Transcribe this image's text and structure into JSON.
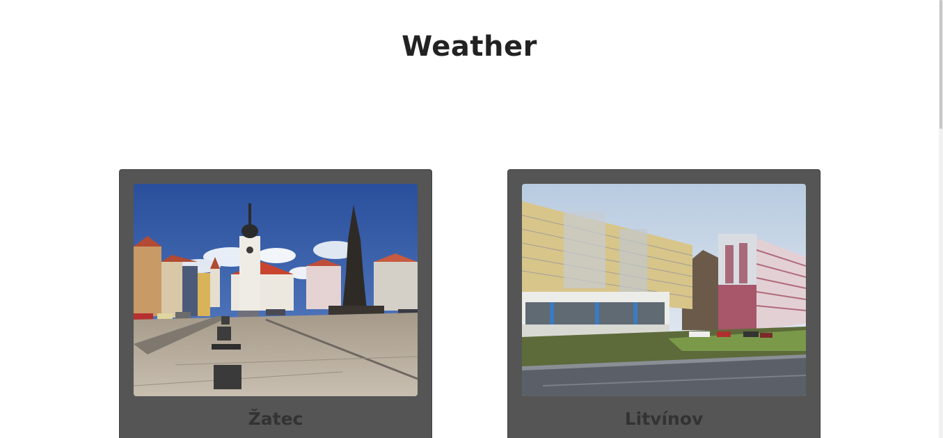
{
  "header": {
    "title": "Weather"
  },
  "cities": [
    {
      "name": "Žatec",
      "image": "zatec-square-photo"
    },
    {
      "name": "Litvínov",
      "image": "litvinov-apartment-blocks-photo"
    }
  ],
  "colors": {
    "card_background": "#555555",
    "title": "#222222",
    "label": "#333333"
  }
}
